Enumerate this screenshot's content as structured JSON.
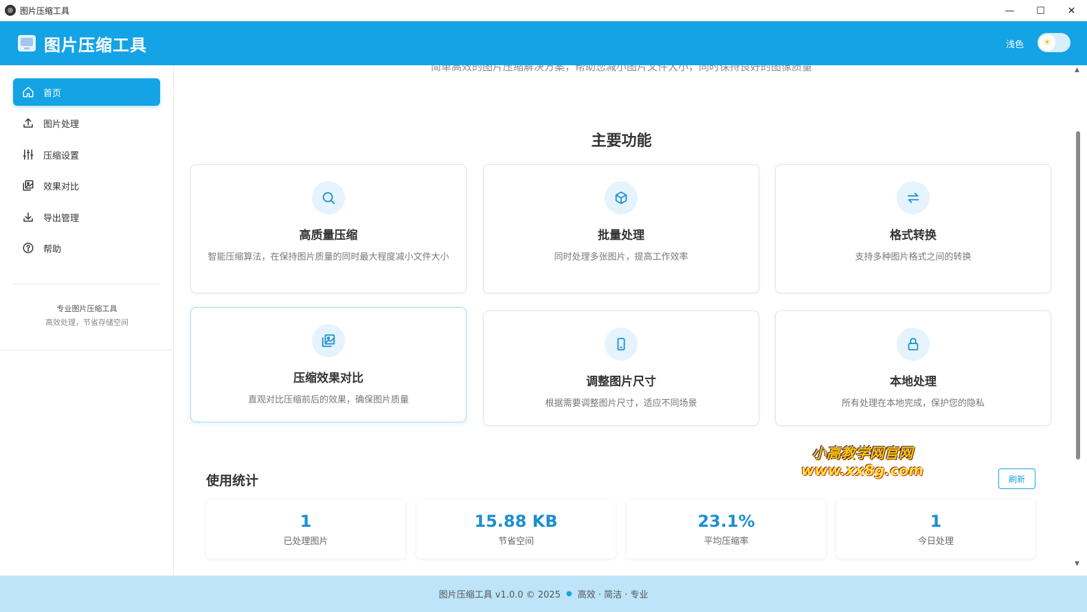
{
  "window": {
    "title": "图片压缩工具",
    "minimize": "—",
    "maximize": "☐",
    "close": "✕"
  },
  "header": {
    "app_name": "图片压缩工具",
    "theme_label": "浅色",
    "theme_icon": "☀"
  },
  "sidebar": {
    "items": [
      {
        "label": "首页",
        "icon": "home-icon",
        "active": true
      },
      {
        "label": "图片处理",
        "icon": "upload-icon",
        "active": false
      },
      {
        "label": "压缩设置",
        "icon": "sliders-icon",
        "active": false
      },
      {
        "label": "效果对比",
        "icon": "image-compare-icon",
        "active": false
      },
      {
        "label": "导出管理",
        "icon": "download-icon",
        "active": false
      },
      {
        "label": "帮助",
        "icon": "help-icon",
        "active": false
      }
    ],
    "info_title": "专业图片压缩工具",
    "info_sub": "高效处理，节省存储空间"
  },
  "main": {
    "cut_text": "简单高效的图片压缩解决方案，帮助您减小图片文件大小，同时保持良好的图像质量",
    "features_title": "主要功能",
    "features": [
      {
        "title": "高质量压缩",
        "desc": "智能压缩算法，在保持图片质量的同时最大程度减小文件大小",
        "icon": "search-icon"
      },
      {
        "title": "批量处理",
        "desc": "同时处理多张图片，提高工作效率",
        "icon": "box-icon"
      },
      {
        "title": "格式转换",
        "desc": "支持多种图片格式之间的转换",
        "icon": "convert-icon"
      },
      {
        "title": "压缩效果对比",
        "desc": "直观对比压缩前后的效果，确保图片质量",
        "icon": "gallery-icon"
      },
      {
        "title": "调整图片尺寸",
        "desc": "根据需要调整图片尺寸，适应不同场景",
        "icon": "mobile-icon"
      },
      {
        "title": "本地处理",
        "desc": "所有处理在本地完成，保护您的隐私",
        "icon": "lock-icon"
      }
    ],
    "stats_title": "使用统计",
    "refresh_label": "刷新",
    "stats": [
      {
        "value": "1",
        "label": "已处理图片"
      },
      {
        "value": "15.88 KB",
        "label": "节省空间"
      },
      {
        "value": "23.1%",
        "label": "平均压缩率"
      },
      {
        "value": "1",
        "label": "今日处理"
      }
    ]
  },
  "watermark": {
    "line1": "小高教学网官网",
    "line2": "www.xx8g.com"
  },
  "footer": {
    "left": "图片压缩工具 v1.0.0 © 2025",
    "right": "高效 · 简洁 · 专业"
  },
  "colors": {
    "accent": "#14a3e4",
    "header_bg": "#14a3e4",
    "footer_bg": "#bde4f8",
    "stat_value": "#1d8fd0"
  }
}
